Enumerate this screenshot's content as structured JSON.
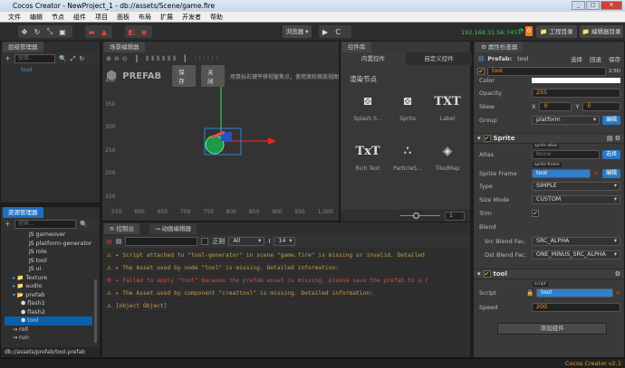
{
  "window": {
    "title": "Cocos Creator - NewProject_1 - db://assets/Scene/game.fire",
    "controls": [
      "_",
      "□",
      "✕"
    ]
  },
  "menu": [
    "文件",
    "编辑",
    "节点",
    "组件",
    "项目",
    "面板",
    "布局",
    "扩展",
    "开发者",
    "帮助"
  ],
  "toolbar": {
    "browser": "浏览器 ▾",
    "ip": "192.168.31.56:7457",
    "badge": "0",
    "project_dir": "工程目录",
    "editor_dir": "编辑器目录"
  },
  "hierarchy": {
    "tab": "层级管理器",
    "search_placeholder": "搜索...",
    "items": [
      "tool"
    ]
  },
  "assets": {
    "tab": "资源管理器",
    "search_placeholder": "搜索...",
    "items": [
      {
        "label": "gameover",
        "type": "script",
        "indent": 3
      },
      {
        "label": "platform-generator",
        "type": "script",
        "indent": 3
      },
      {
        "label": "role",
        "type": "script",
        "indent": 3
      },
      {
        "label": "tool",
        "type": "script",
        "indent": 3
      },
      {
        "label": "ui",
        "type": "script",
        "indent": 3
      },
      {
        "label": "Texture",
        "type": "folder",
        "indent": 1
      },
      {
        "label": "audio",
        "type": "folder",
        "indent": 1
      },
      {
        "label": "prefab",
        "type": "folder-open",
        "indent": 1
      },
      {
        "label": "flash1",
        "type": "prefab",
        "indent": 2
      },
      {
        "label": "flash2",
        "type": "prefab",
        "indent": 2
      },
      {
        "label": "tool",
        "type": "prefab",
        "indent": 2,
        "selected": true
      },
      {
        "label": "roll",
        "type": "anim",
        "indent": 1
      },
      {
        "label": "run",
        "type": "anim",
        "indent": 1
      }
    ],
    "path": "db://assets/prefab/tool.prefab"
  },
  "scene": {
    "tab": "场景编辑器",
    "prefab_label": "PREFAB",
    "save": "保存",
    "close": "关闭",
    "hint": "用鼠标右键平移视窗焦点，使用滚轮缩放视图",
    "y_ticks": [
      "400",
      "350",
      "300",
      "250",
      "200",
      "150"
    ],
    "x_ticks": [
      "550",
      "600",
      "650",
      "700",
      "750",
      "800",
      "850",
      "900",
      "950",
      "1,000"
    ]
  },
  "library": {
    "tab": "控件库",
    "tabs": [
      "内置控件",
      "自定义控件"
    ],
    "section": "渲染节点",
    "items": [
      {
        "label": "Splash S...",
        "glyph": "⊠"
      },
      {
        "label": "Sprite",
        "glyph": "⊠"
      },
      {
        "label": "Label",
        "glyph": "TXT"
      },
      {
        "label": "Rich Text",
        "glyph": "TxT"
      },
      {
        "label": "ParticleS...",
        "glyph": "∴"
      },
      {
        "label": "TiledMap",
        "glyph": "◈"
      }
    ],
    "zoom_value": "1"
  },
  "console": {
    "tabs": [
      "控制台",
      "动画编辑器"
    ],
    "regex": "正则",
    "level": "All",
    "font_size": "14",
    "logs": [
      {
        "level": "warn",
        "text": "▸ Script attached to \"tool-generator\" in scene \"game.fire\" is missing or invalid. Detailed"
      },
      {
        "level": "warn",
        "text": "▸ The Asset used by node \"tool\" is missing. Detailed information:"
      },
      {
        "level": "error",
        "text": "▸ Failed to apply \"tool\" because the prefab asset is missing, please save the prefab to a r"
      },
      {
        "level": "warn",
        "text": "▸ The Asset used by component \"creattool\" is missing. Detailed information:"
      },
      {
        "level": "warn",
        "text": "[object Object]"
      }
    ]
  },
  "inspector": {
    "tab": "属性检查器",
    "prefab_label": "Prefab:",
    "prefab_name": "tool",
    "actions": [
      "选择",
      "回退",
      "保存"
    ],
    "node_name": "tool",
    "mode": "2.5D",
    "color_label": "Color",
    "color": "#ffffff",
    "opacity_label": "Opacity",
    "opacity": "255",
    "skew_label": "Skew",
    "skew_x": "0",
    "skew_y": "0",
    "group_label": "Group",
    "group": "platform",
    "edit": "编辑",
    "sprite": {
      "title": "Sprite",
      "atlas_label": "Atlas",
      "atlas_tag": "sprite-atlas",
      "atlas": "None",
      "select": "选择",
      "frame_label": "Sprite Frame",
      "frame_tag": "sprite-frame",
      "frame": "tool",
      "edit": "编辑",
      "type_label": "Type",
      "type": "SIMPLE",
      "size_label": "Size Mode",
      "size": "CUSTOM",
      "trim_label": "Trim",
      "blend_label": "Blend",
      "src_label": "Src Blend Fac...",
      "src": "SRC_ALPHA",
      "dst_label": "Dst Blend Fac...",
      "dst": "ONE_MINUS_SRC_ALPHA"
    },
    "tool": {
      "title": "tool",
      "script_label": "Script",
      "script_tag": "script",
      "script": "tool",
      "speed_label": "Speed",
      "speed": "200"
    },
    "add_component": "添加组件"
  },
  "status": {
    "version": "Cocos Creator v2.1"
  },
  "colors": {
    "accent": "#1f6fc1",
    "orange": "#f09a30",
    "warn": "#c99a4a",
    "error": "#d14b4b",
    "ip": "#3cc35a"
  }
}
